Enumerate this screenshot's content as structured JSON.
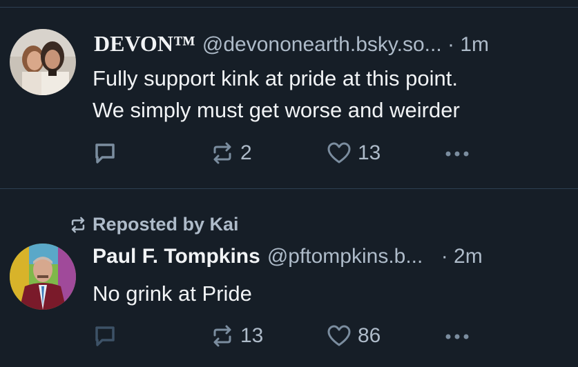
{
  "posts": [
    {
      "author_name": "DEVON™",
      "handle": "@devononearth.bsky.so...",
      "separator": "·",
      "time": "1m",
      "lines": [
        "Fully support kink at pride at this point.",
        "We simply must get worse and weirder"
      ],
      "reply_count": "",
      "repost_count": "2",
      "like_count": "13",
      "more_icon": "ellipsis-icon"
    },
    {
      "repost_label": "Reposted by Kai",
      "author_name": "Paul F. Tompkins",
      "handle": "@pftompkins.b...",
      "separator": "·",
      "time": "2m",
      "lines": [
        "No grink at Pride"
      ],
      "reply_count": "",
      "repost_count": "13",
      "like_count": "86",
      "more_icon": "ellipsis-icon"
    }
  ],
  "colors": {
    "background": "#161e27",
    "text": "#f1f3f5",
    "muted": "#aebbc9",
    "icon": "#7b8d9f",
    "divider": "#2e4052"
  }
}
